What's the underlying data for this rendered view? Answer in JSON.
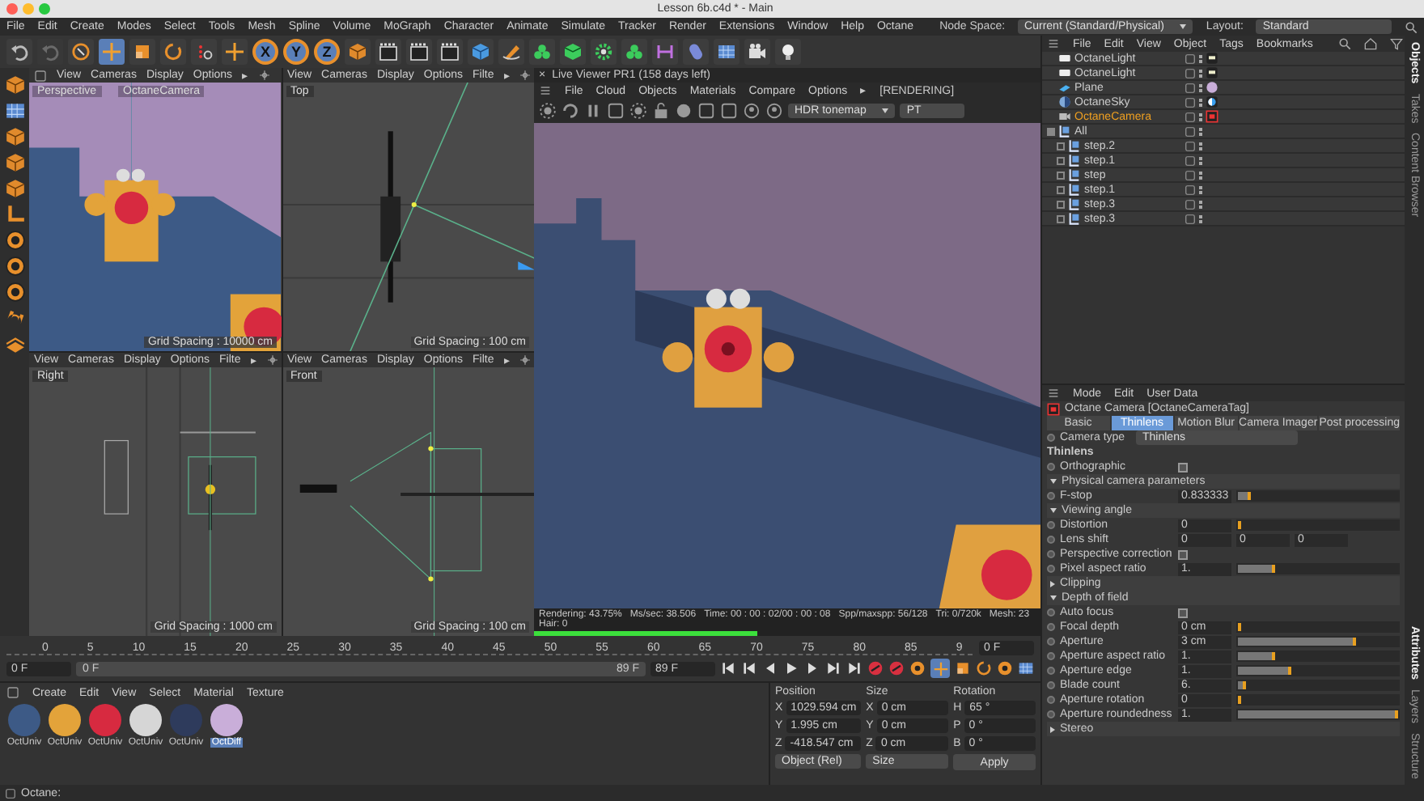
{
  "window": {
    "title": "Lesson 6b.c4d * - Main"
  },
  "menu_bar": [
    "File",
    "Edit",
    "Create",
    "Modes",
    "Select",
    "Tools",
    "Mesh",
    "Spline",
    "Volume",
    "MoGraph",
    "Character",
    "Animate",
    "Simulate",
    "Tracker",
    "Render",
    "Extensions",
    "Window",
    "Help",
    "Octane"
  ],
  "node_space": {
    "label": "Node Space:",
    "value": "Current (Standard/Physical)"
  },
  "layout": {
    "label": "Layout:",
    "value": "Standard"
  },
  "toolbar": {
    "axis_buttons": [
      "X",
      "Y",
      "Z"
    ]
  },
  "viewports": [
    {
      "kind": "perspective",
      "menu": [
        "View",
        "Cameras",
        "Display",
        "Options"
      ],
      "more": "▸",
      "name": "Perspective",
      "camera": "OctaneCamera",
      "grid_spacing": "Grid Spacing : 10000 cm"
    },
    {
      "kind": "top",
      "menu": [
        "View",
        "Cameras",
        "Display",
        "Options",
        "Filte"
      ],
      "more": "▸",
      "name": "Top",
      "grid_spacing": "Grid Spacing : 100 cm"
    },
    {
      "kind": "right",
      "menu": [
        "View",
        "Cameras",
        "Display",
        "Options",
        "Filte"
      ],
      "more": "▸",
      "name": "Right",
      "grid_spacing": "Grid Spacing : 1000 cm"
    },
    {
      "kind": "front",
      "menu": [
        "View",
        "Cameras",
        "Display",
        "Options",
        "Filte"
      ],
      "more": "▸",
      "name": "Front",
      "grid_spacing": "Grid Spacing : 100 cm"
    }
  ],
  "live_viewer": {
    "close": "×",
    "title": "Live Viewer PR1 (158 days left)",
    "menu": [
      "File",
      "Cloud",
      "Objects",
      "Materials",
      "Compare",
      "Options"
    ],
    "more": "▸",
    "status": "[RENDERING]",
    "tonemap": "HDR tonemap",
    "kernel": "PT",
    "progress": {
      "level": 0.44
    },
    "stats": [
      "Rendering: 43.75%",
      "Ms/sec: 38.506",
      "Time: 00 : 00 : 02/00 : 00 : 08",
      "Spp/maxspp: 56/128",
      "Tri: 0/720k",
      "Mesh: 23",
      "Hair: 0"
    ]
  },
  "timeline": {
    "ticks": [
      "0",
      "5",
      "10",
      "15",
      "20",
      "25",
      "30",
      "35",
      "40",
      "45",
      "50",
      "55",
      "60",
      "65",
      "70",
      "75",
      "80",
      "85",
      "9"
    ],
    "current_frame": "0 F",
    "start": "0 F",
    "range_start": "0 F",
    "range_end": "89 F",
    "end": "89 F"
  },
  "materials": {
    "menu": [
      "Create",
      "Edit",
      "View",
      "Select",
      "Material",
      "Texture"
    ],
    "items": [
      {
        "name": "OctUniv",
        "color": "#3d5a86",
        "selected": false
      },
      {
        "name": "OctUniv",
        "color": "#e3a33a",
        "selected": false
      },
      {
        "name": "OctUniv",
        "color": "#d72a40",
        "selected": false
      },
      {
        "name": "OctUniv",
        "color": "#d6d6d6",
        "selected": false
      },
      {
        "name": "OctUniv",
        "color": "#2e3b5c",
        "selected": false
      },
      {
        "name": "OctDiff",
        "color": "#c9aed9",
        "selected": true
      }
    ]
  },
  "coordinates": {
    "headers": [
      "Position",
      "Size",
      "Rotation"
    ],
    "rows": [
      {
        "axis": "X",
        "position": "1029.594 cm",
        "size_axis": "X",
        "size": "0 cm",
        "rotation_axis": "H",
        "rotation": "65 °"
      },
      {
        "axis": "Y",
        "position": "1.995 cm",
        "size_axis": "Y",
        "size": "0 cm",
        "rotation_axis": "P",
        "rotation": "0 °"
      },
      {
        "axis": "Z",
        "position": "-418.547 cm",
        "size_axis": "Z",
        "size": "0 cm",
        "rotation_axis": "B",
        "rotation": "0 °"
      }
    ],
    "mode": "Object (Rel)",
    "size_mode": "Size",
    "apply": "Apply"
  },
  "object_manager": {
    "menu": [
      "File",
      "Edit",
      "View",
      "Object",
      "Tags",
      "Bookmarks"
    ],
    "objects": [
      {
        "name": "OctaneLight",
        "kind": "light",
        "selected": false
      },
      {
        "name": "OctaneLight",
        "kind": "light",
        "selected": false
      },
      {
        "name": "Plane",
        "kind": "plane",
        "selected": false
      },
      {
        "name": "OctaneSky",
        "kind": "sky",
        "selected": false
      },
      {
        "name": "OctaneCamera",
        "kind": "camera",
        "selected": true
      },
      {
        "name": "All",
        "kind": "null",
        "selected": false,
        "expanded": true,
        "children": [
          {
            "name": "step.2",
            "kind": "null",
            "selected": false,
            "expanded": false
          },
          {
            "name": "step.1",
            "kind": "null",
            "selected": false,
            "expanded": false
          },
          {
            "name": "step",
            "kind": "null",
            "selected": false,
            "expanded": false
          },
          {
            "name": "step.1",
            "kind": "null",
            "selected": false,
            "expanded": false
          },
          {
            "name": "step.3",
            "kind": "null",
            "selected": false,
            "expanded": false
          },
          {
            "name": "step.3",
            "kind": "null",
            "selected": false,
            "expanded": false
          }
        ]
      }
    ]
  },
  "attributes": {
    "menu": [
      "Mode",
      "Edit",
      "User Data"
    ],
    "title": "Octane Camera [OctaneCameraTag]",
    "tabs": [
      {
        "label": "Basic",
        "selected": false
      },
      {
        "label": "Thinlens",
        "selected": true
      },
      {
        "label": "Motion Blur",
        "selected": false
      },
      {
        "label": "Camera Imager",
        "selected": false
      },
      {
        "label": "Post processing",
        "selected": false
      }
    ],
    "camera_type": {
      "label": "Camera type",
      "value": "Thinlens"
    },
    "section": "Thinlens",
    "items": [
      {
        "kind": "checkbox",
        "label": "Orthographic",
        "checked": false
      },
      {
        "kind": "group",
        "label": "Physical camera parameters",
        "expanded": true,
        "children": [
          {
            "kind": "slider",
            "label": "F-stop",
            "value": "0.833333",
            "level": 0.08
          }
        ]
      },
      {
        "kind": "group",
        "label": "Viewing angle",
        "expanded": true,
        "children": [
          {
            "kind": "slider",
            "label": "Distortion",
            "value": "0",
            "level": 0
          },
          {
            "kind": "vector",
            "label": "Lens shift",
            "values": [
              "0",
              "0",
              "0"
            ]
          },
          {
            "kind": "checkbox",
            "label": "Perspective correction",
            "checked": false
          },
          {
            "kind": "slider",
            "label": "Pixel aspect ratio",
            "value": "1.",
            "level": 0.23
          }
        ]
      },
      {
        "kind": "group",
        "label": "Clipping",
        "expanded": false
      },
      {
        "kind": "group",
        "label": "Depth of field",
        "expanded": true,
        "children": [
          {
            "kind": "checkbox",
            "label": "Auto focus",
            "checked": false
          },
          {
            "kind": "slider",
            "label": "Focal depth",
            "value": "0 cm",
            "level": 0
          },
          {
            "kind": "slider",
            "label": "Aperture",
            "value": "3 cm",
            "level": 0.74
          },
          {
            "kind": "slider",
            "label": "Aperture aspect ratio",
            "value": "1.",
            "level": 0.23
          },
          {
            "kind": "slider",
            "label": "Aperture edge",
            "value": "1.",
            "level": 0.33
          },
          {
            "kind": "slider",
            "label": "Blade count",
            "value": "6.",
            "level": 0.05
          },
          {
            "kind": "slider",
            "label": "Aperture rotation",
            "value": "0",
            "level": 0
          },
          {
            "kind": "slider",
            "label": "Aperture roundedness",
            "value": "1.",
            "level": 1
          }
        ]
      },
      {
        "kind": "group",
        "label": "Stereo",
        "expanded": false
      }
    ]
  },
  "side_tabs_top": [
    {
      "label": "Objects",
      "selected": true
    },
    {
      "label": "Takes",
      "selected": false
    },
    {
      "label": "Content Browser",
      "selected": false
    }
  ],
  "side_tabs_bottom": [
    {
      "label": "Attributes",
      "selected": true
    },
    {
      "label": "Layers",
      "selected": false
    },
    {
      "label": "Structure",
      "selected": false
    }
  ],
  "status_bar": {
    "text": "Octane:"
  }
}
